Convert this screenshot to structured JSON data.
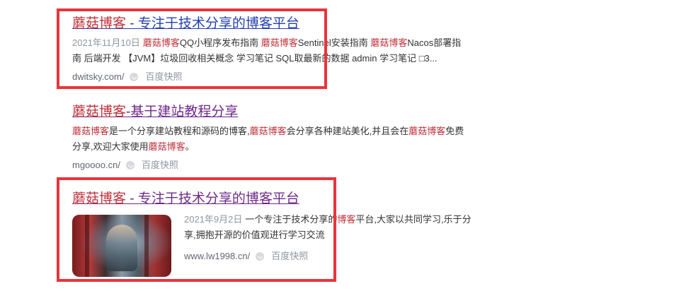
{
  "results": [
    {
      "title_em": "蘑菇博客",
      "title_rest": " - 专注于技术分享的博客平台",
      "date": "2021年11月10日",
      "abstract_line1": [
        {
          "em": "蘑菇博客"
        },
        {
          "t": "QQ小程序发布指南 "
        },
        {
          "em": "蘑菇博客"
        },
        {
          "t": "Sentinel安装指南 "
        },
        {
          "em": "蘑菇博客"
        },
        {
          "t": "Nacos部署指"
        }
      ],
      "abstract_line2": "南 后端开发 【JVM】垃圾回收相关概念 学习笔记 SQL取最新的数据 admin 学习笔记 □3...",
      "url": "dwitsky.com/",
      "snapshot": "百度快照"
    },
    {
      "title_em": "蘑菇博客",
      "title_rest": "-基于建站教程分享",
      "abstract_line1": [
        {
          "em": "蘑菇博客"
        },
        {
          "t": "是一个分享建站教程和源码的博客,"
        },
        {
          "em": "蘑菇博客"
        },
        {
          "t": "会分享各种建站美化,并且会在"
        },
        {
          "em": "蘑菇博客"
        },
        {
          "t": "免费"
        }
      ],
      "abstract_line2_pre": "分享,欢迎大家使用",
      "abstract_line2_em": "蘑菇博客",
      "abstract_line2_post": "。",
      "url": "mgoooo.cn/",
      "snapshot": "百度快照"
    },
    {
      "title_em": "蘑菇博客",
      "title_rest": " - 专注于技术分享的博客平台",
      "date": "2021年9月2日",
      "abstract_line1_pre": "一个专注于技术分享的",
      "abstract_line1_em": "博客",
      "abstract_line1_post": "平台,大家以共同学习,乐于分",
      "abstract_line2": "享,拥抱开源的价值观进行学习交流",
      "url": "www.lw1998.cn/",
      "snapshot": "百度快照"
    }
  ],
  "colors": {
    "highlight_box": "#e8343a",
    "title_link": "#2440b3",
    "title_visited": "#6e2a8a",
    "em_red": "#c0303a"
  }
}
